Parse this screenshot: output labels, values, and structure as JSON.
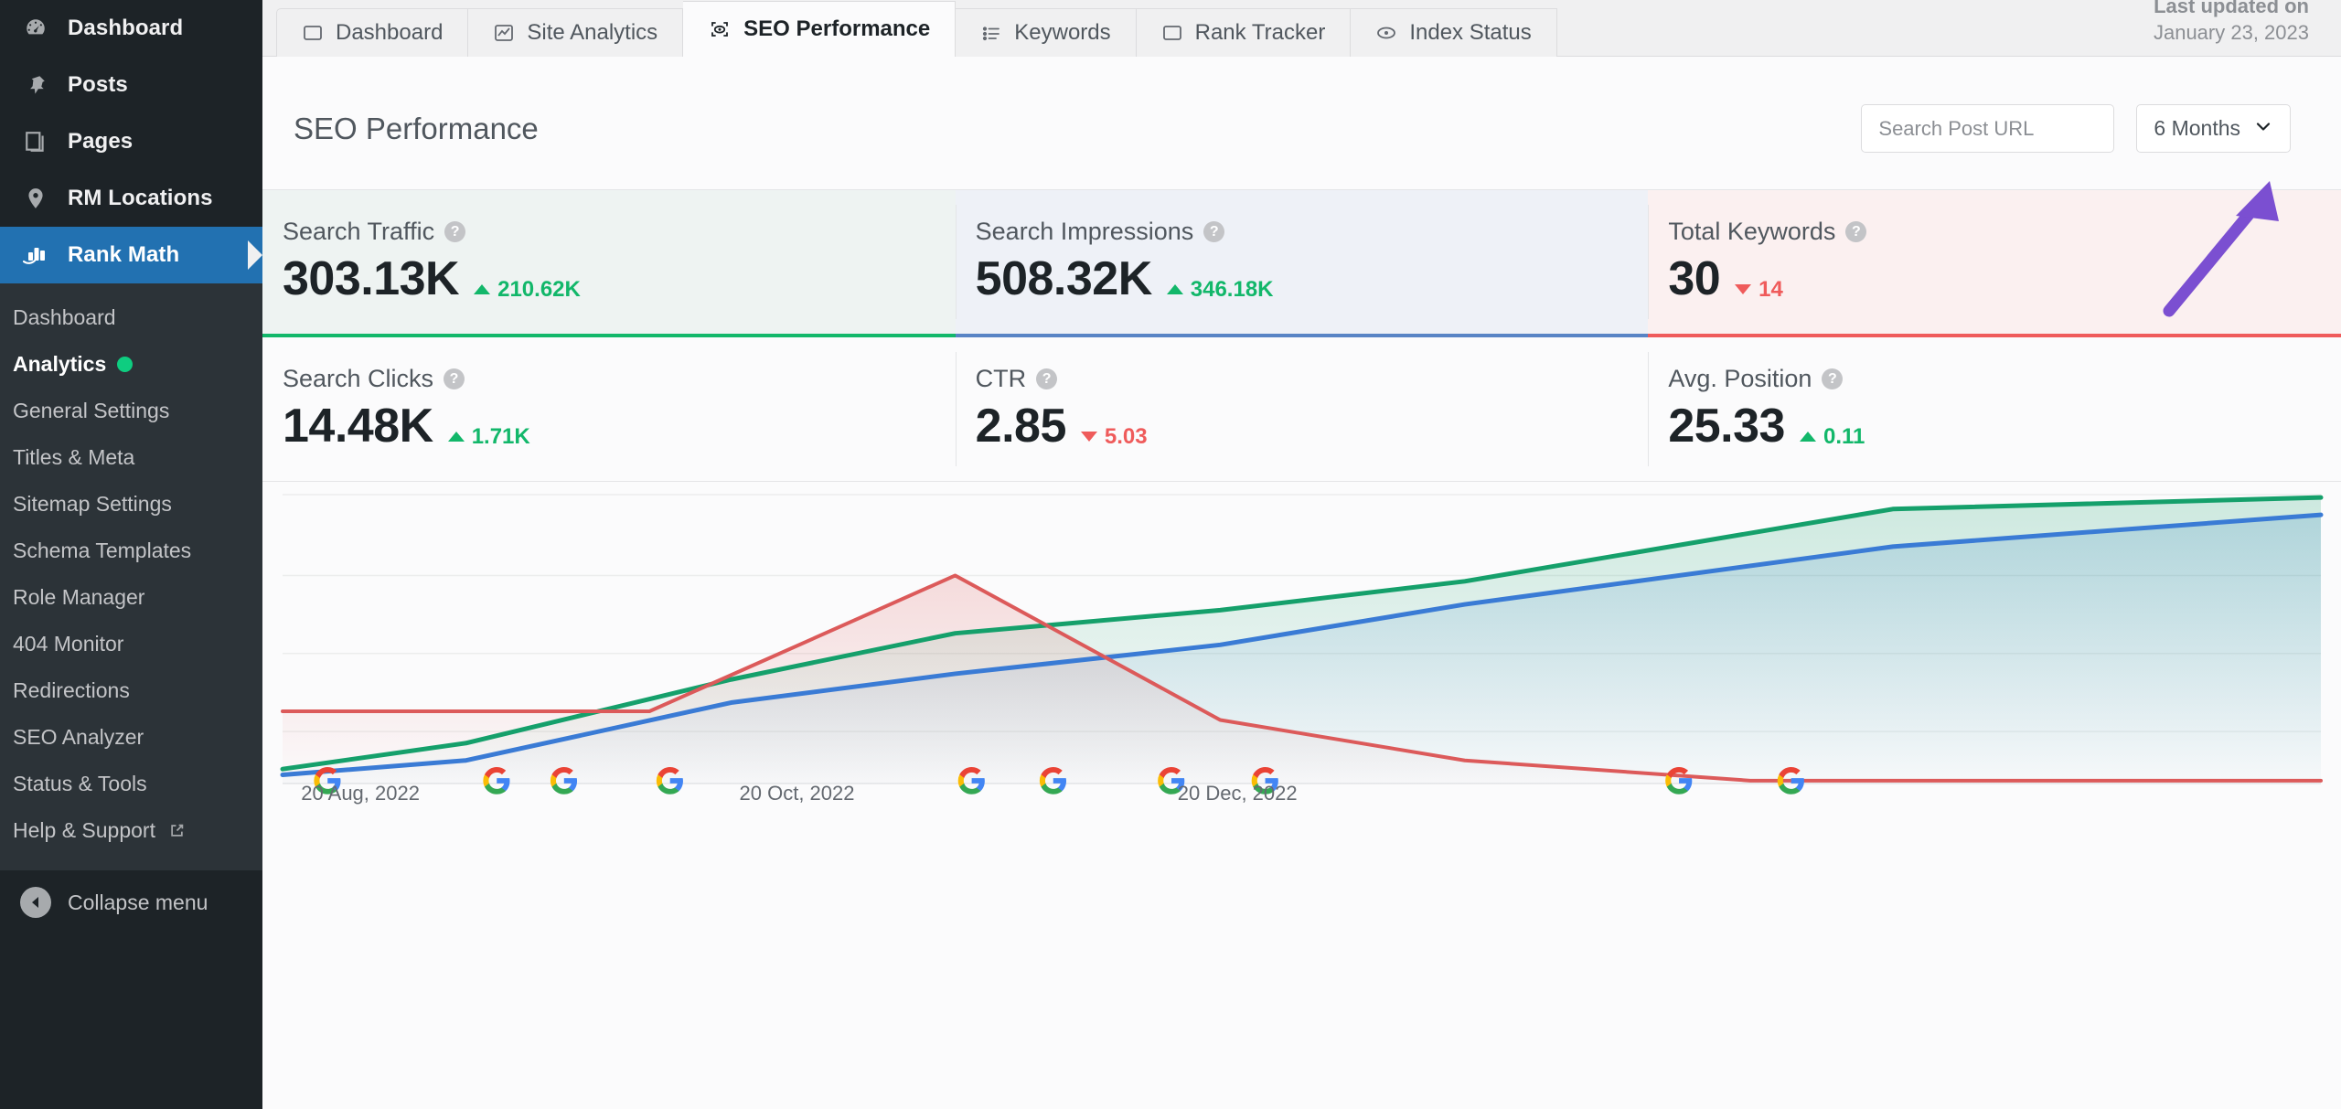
{
  "sidebar": {
    "wp_items": [
      {
        "label": "Dashboard",
        "icon": "dashboard-icon"
      },
      {
        "label": "Posts",
        "icon": "pin-icon"
      },
      {
        "label": "Pages",
        "icon": "page-icon"
      },
      {
        "label": "RM Locations",
        "icon": "location-pin-icon"
      },
      {
        "label": "Rank Math",
        "icon": "rank-math-icon",
        "active": true
      }
    ],
    "submenu": [
      {
        "label": "Dashboard"
      },
      {
        "label": "Analytics",
        "current": true,
        "badge": "green-dot"
      },
      {
        "label": "General Settings"
      },
      {
        "label": "Titles & Meta"
      },
      {
        "label": "Sitemap Settings"
      },
      {
        "label": "Schema Templates"
      },
      {
        "label": "Role Manager"
      },
      {
        "label": "404 Monitor"
      },
      {
        "label": "Redirections"
      },
      {
        "label": "SEO Analyzer"
      },
      {
        "label": "Status & Tools"
      },
      {
        "label": "Help & Support",
        "external": true
      }
    ],
    "collapse_label": "Collapse menu",
    "active_color": "#2271b1",
    "dot_color": "#0ecd80"
  },
  "tabs": [
    {
      "label": "Dashboard",
      "icon": "window-icon",
      "active": false
    },
    {
      "label": "Site Analytics",
      "icon": "chart-image-icon",
      "active": false
    },
    {
      "label": "SEO Performance",
      "icon": "eye-brackets-icon",
      "active": true
    },
    {
      "label": "Keywords",
      "icon": "list-icon",
      "active": false
    },
    {
      "label": "Rank Tracker",
      "icon": "window-icon",
      "active": false
    },
    {
      "label": "Index Status",
      "icon": "eye-icon",
      "active": false
    }
  ],
  "last_updated": {
    "line1": "Last updated on",
    "line2": "January 23, 2023"
  },
  "header": {
    "title": "SEO Performance",
    "search_placeholder": "Search Post URL",
    "search_value": "",
    "search_icon": "search-icon",
    "range_label": "6 Months",
    "range_icon": "chevron-down-icon"
  },
  "stats": [
    {
      "label": "Search Traffic",
      "value": "303.13K",
      "delta": "210.62K",
      "direction": "up",
      "accent": "#12b76a",
      "bg": "#eef3f2"
    },
    {
      "label": "Search Impressions",
      "value": "508.32K",
      "delta": "346.18K",
      "direction": "up",
      "accent": "#5884c5",
      "bg": "#eef1f7"
    },
    {
      "label": "Total Keywords",
      "value": "30",
      "delta": "14",
      "direction": "down",
      "accent": "#ef5b5b",
      "bg": "#fbf0f0"
    },
    {
      "label": "Search Clicks",
      "value": "14.48K",
      "delta": "1.71K",
      "direction": "up",
      "accent": "#12b76a",
      "bg": "#fbfbfc"
    },
    {
      "label": "CTR",
      "value": "2.85",
      "delta": "5.03",
      "direction": "down",
      "accent": "#ef5b5b",
      "bg": "#fbfbfc"
    },
    {
      "label": "Avg. Position",
      "value": "25.33",
      "delta": "0.11",
      "direction": "up",
      "accent": "#12b76a",
      "bg": "#fbfbfc"
    }
  ],
  "chart_data": {
    "type": "line",
    "title": "SEO Performance",
    "xlabel": "",
    "ylabel": "",
    "grid": true,
    "legend": "none",
    "x_tick_labels": [
      "20 Aug, 2022",
      "20 Oct, 2022",
      "20 Dec, 2022"
    ],
    "x_tick_positions_pct": [
      1.0,
      22.5,
      44.0
    ],
    "annotations": {
      "type": "google-algorithm-update-icon",
      "positions_pct": [
        2.2,
        10.5,
        13.8,
        19.0,
        33.8,
        37.8,
        43.6,
        48.2,
        68.5,
        74.0
      ]
    },
    "series": [
      {
        "name": "Search Impressions",
        "color": "#3a7bd5",
        "fill": "rgba(88,132,197,0.16)",
        "points_pct": [
          {
            "x": 0,
            "y": 3
          },
          {
            "x": 9,
            "y": 8
          },
          {
            "x": 22,
            "y": 28
          },
          {
            "x": 33,
            "y": 38
          },
          {
            "x": 46,
            "y": 48
          },
          {
            "x": 58,
            "y": 62
          },
          {
            "x": 79,
            "y": 82
          },
          {
            "x": 100,
            "y": 93
          }
        ]
      },
      {
        "name": "Search Traffic",
        "color": "#15a06b",
        "fill": "rgba(18,183,106,0.13)",
        "points_pct": [
          {
            "x": 0,
            "y": 5
          },
          {
            "x": 9,
            "y": 14
          },
          {
            "x": 22,
            "y": 36
          },
          {
            "x": 33,
            "y": 52
          },
          {
            "x": 46,
            "y": 60
          },
          {
            "x": 58,
            "y": 70
          },
          {
            "x": 79,
            "y": 95
          },
          {
            "x": 100,
            "y": 99
          }
        ]
      },
      {
        "name": "Total Keywords",
        "color": "#dc5a5a",
        "fill": "rgba(239,91,91,0.12)",
        "points_pct": [
          {
            "x": 0,
            "y": 25
          },
          {
            "x": 18,
            "y": 25
          },
          {
            "x": 33,
            "y": 72
          },
          {
            "x": 46,
            "y": 22
          },
          {
            "x": 58,
            "y": 8
          },
          {
            "x": 72,
            "y": 1
          },
          {
            "x": 100,
            "y": 1
          }
        ]
      }
    ]
  },
  "annotation_arrow": {
    "color": "#7b4fd1",
    "target": "range-select"
  }
}
